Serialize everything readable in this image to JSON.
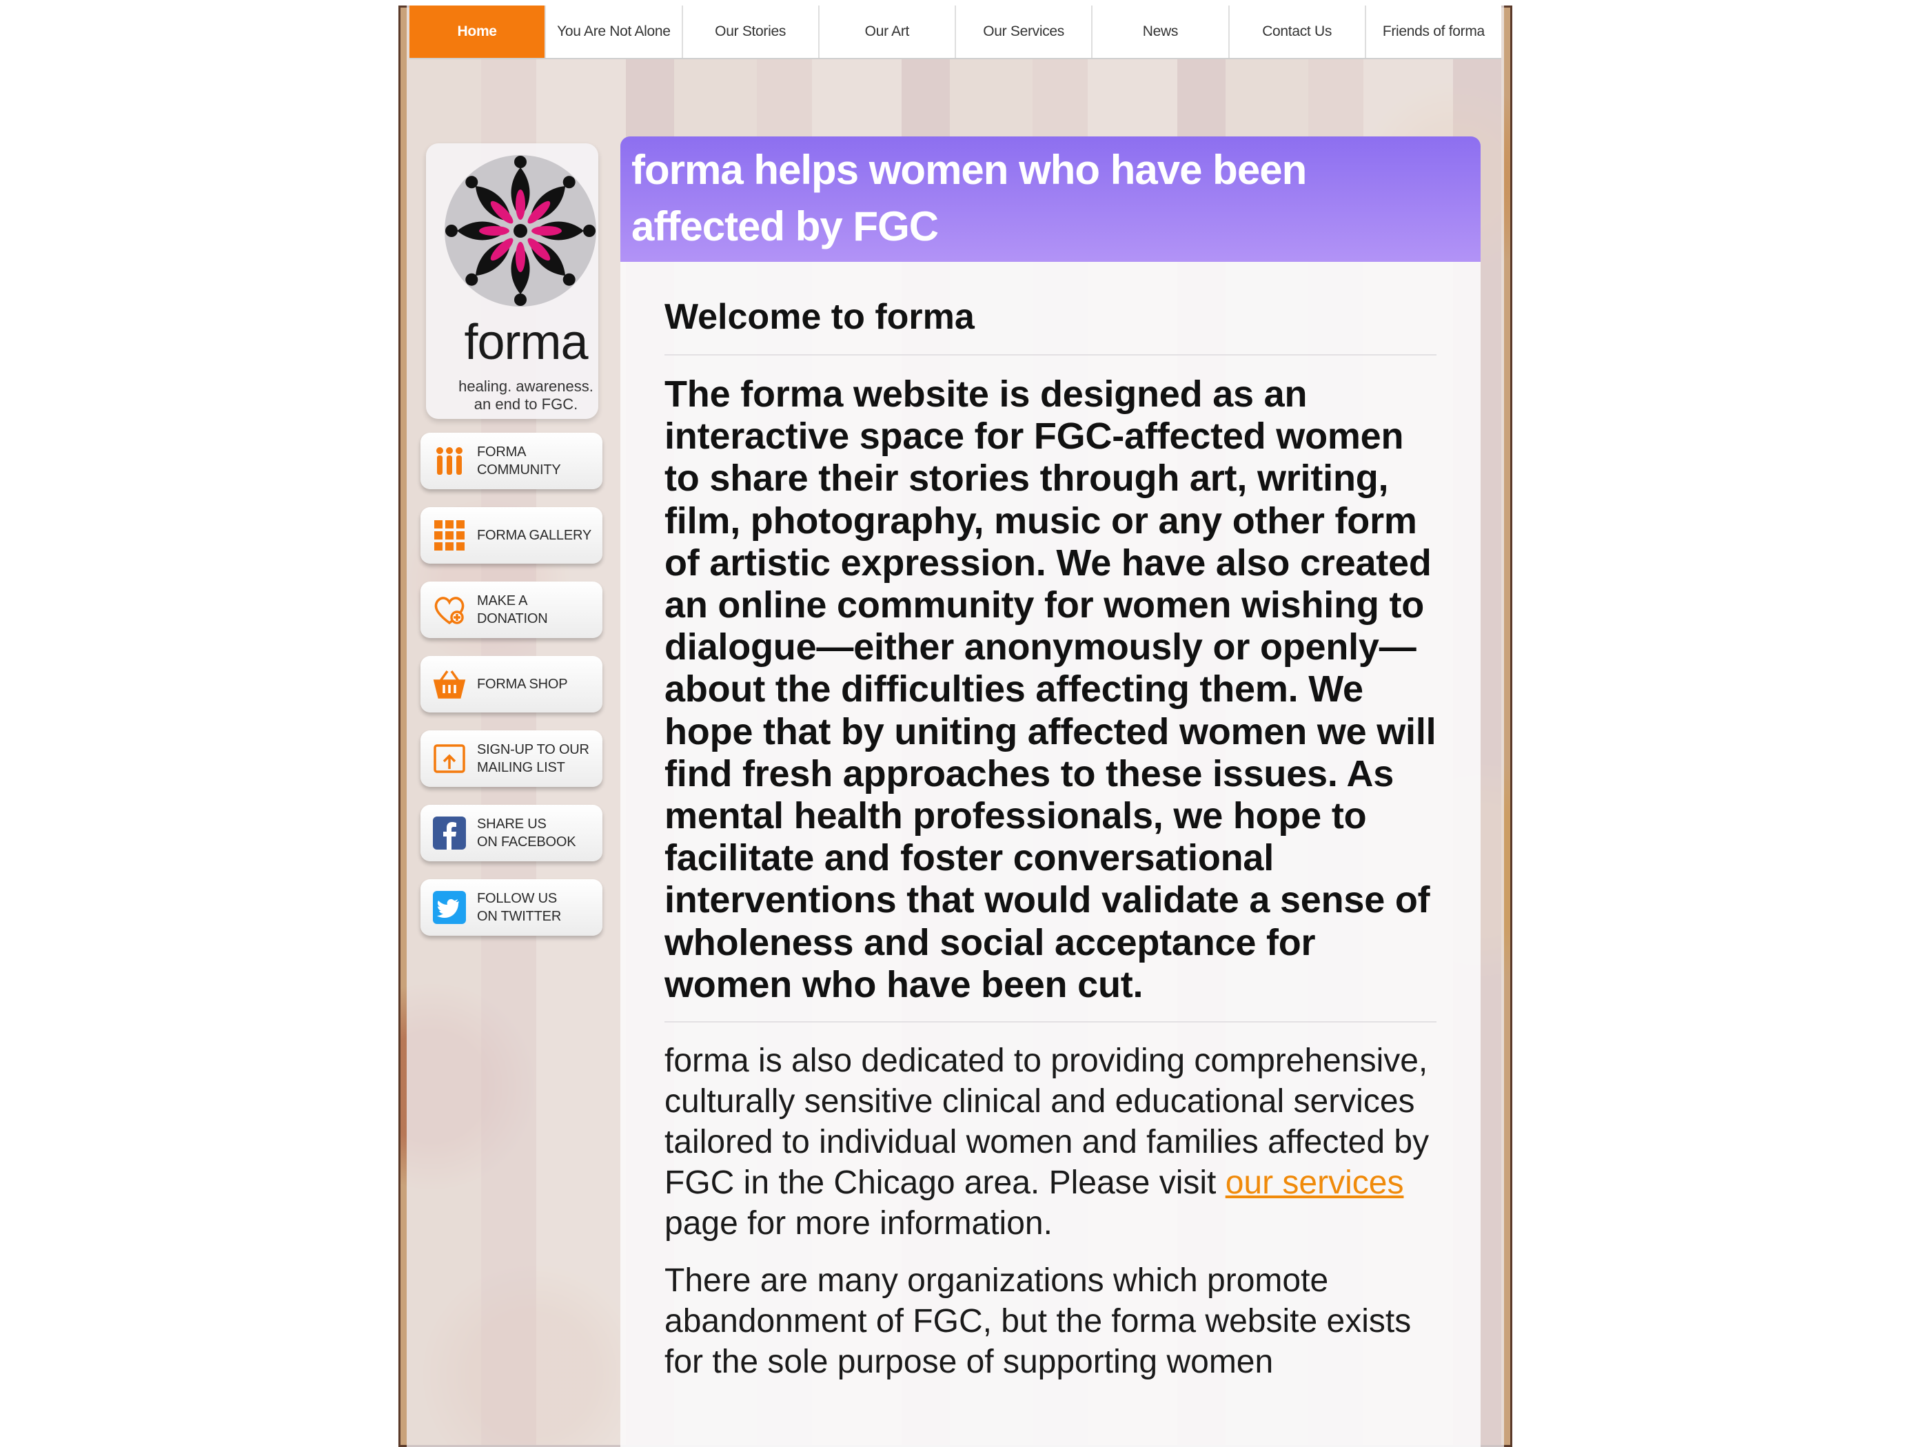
{
  "nav": {
    "tabs": [
      {
        "label": "Home"
      },
      {
        "label": "You Are Not Alone"
      },
      {
        "label": "Our Stories"
      },
      {
        "label": "Our Art"
      },
      {
        "label": "Our Services"
      },
      {
        "label": "News"
      },
      {
        "label": "Contact Us"
      },
      {
        "label": "Friends of forma"
      }
    ]
  },
  "logo": {
    "word": "forma",
    "tagline_1": "healing. awareness.",
    "tagline_2": "an end to FGC."
  },
  "sidebar": {
    "items": [
      {
        "label": "Forma\nCommunity",
        "icon": "people-icon"
      },
      {
        "label": "Forma Gallery",
        "icon": "grid-icon"
      },
      {
        "label": "Make a\nDonation",
        "icon": "heart-donate-icon"
      },
      {
        "label": "Forma Shop",
        "icon": "basket-icon"
      },
      {
        "label": "Sign-up to our\nMailing List",
        "icon": "mail-signup-icon"
      },
      {
        "label": "Share us\non Facebook",
        "icon": "facebook-icon"
      },
      {
        "label": "Follow us\non Twitter",
        "icon": "twitter-icon"
      }
    ]
  },
  "hero": {
    "title": "forma helps women who have been affected by FGC"
  },
  "main": {
    "heading": "Welcome to forma",
    "lead": "The forma website is designed as an interactive space for FGC-affected women to share their stories through art, writing, film, photography, music or any other form of artistic expression. We have also created an online community for women wishing to dialogue—either anonymously or openly—about the difficulties affecting them. We hope that by uniting affected women we will find fresh approaches to these issues. As mental health professionals, we hope to facilitate and foster conversational interventions that would validate a sense of wholeness and social acceptance for women who have been cut.",
    "p1_before": "forma is also dedicated to providing comprehensive, culturally sensitive clinical and educational services tailored to individual women and families affected by FGC in the Chicago area. Please visit ",
    "p1_link": "our services",
    "p1_after": " page for more information.",
    "p2": "There are many organizations which promote abandonment of FGC, but the forma website exists for the sole purpose of supporting women"
  },
  "colors": {
    "accent_orange": "#f47a0d",
    "hero_purple": "#9a7df2",
    "link_orange": "#f08a0a",
    "logo_pink": "#e0167a"
  }
}
